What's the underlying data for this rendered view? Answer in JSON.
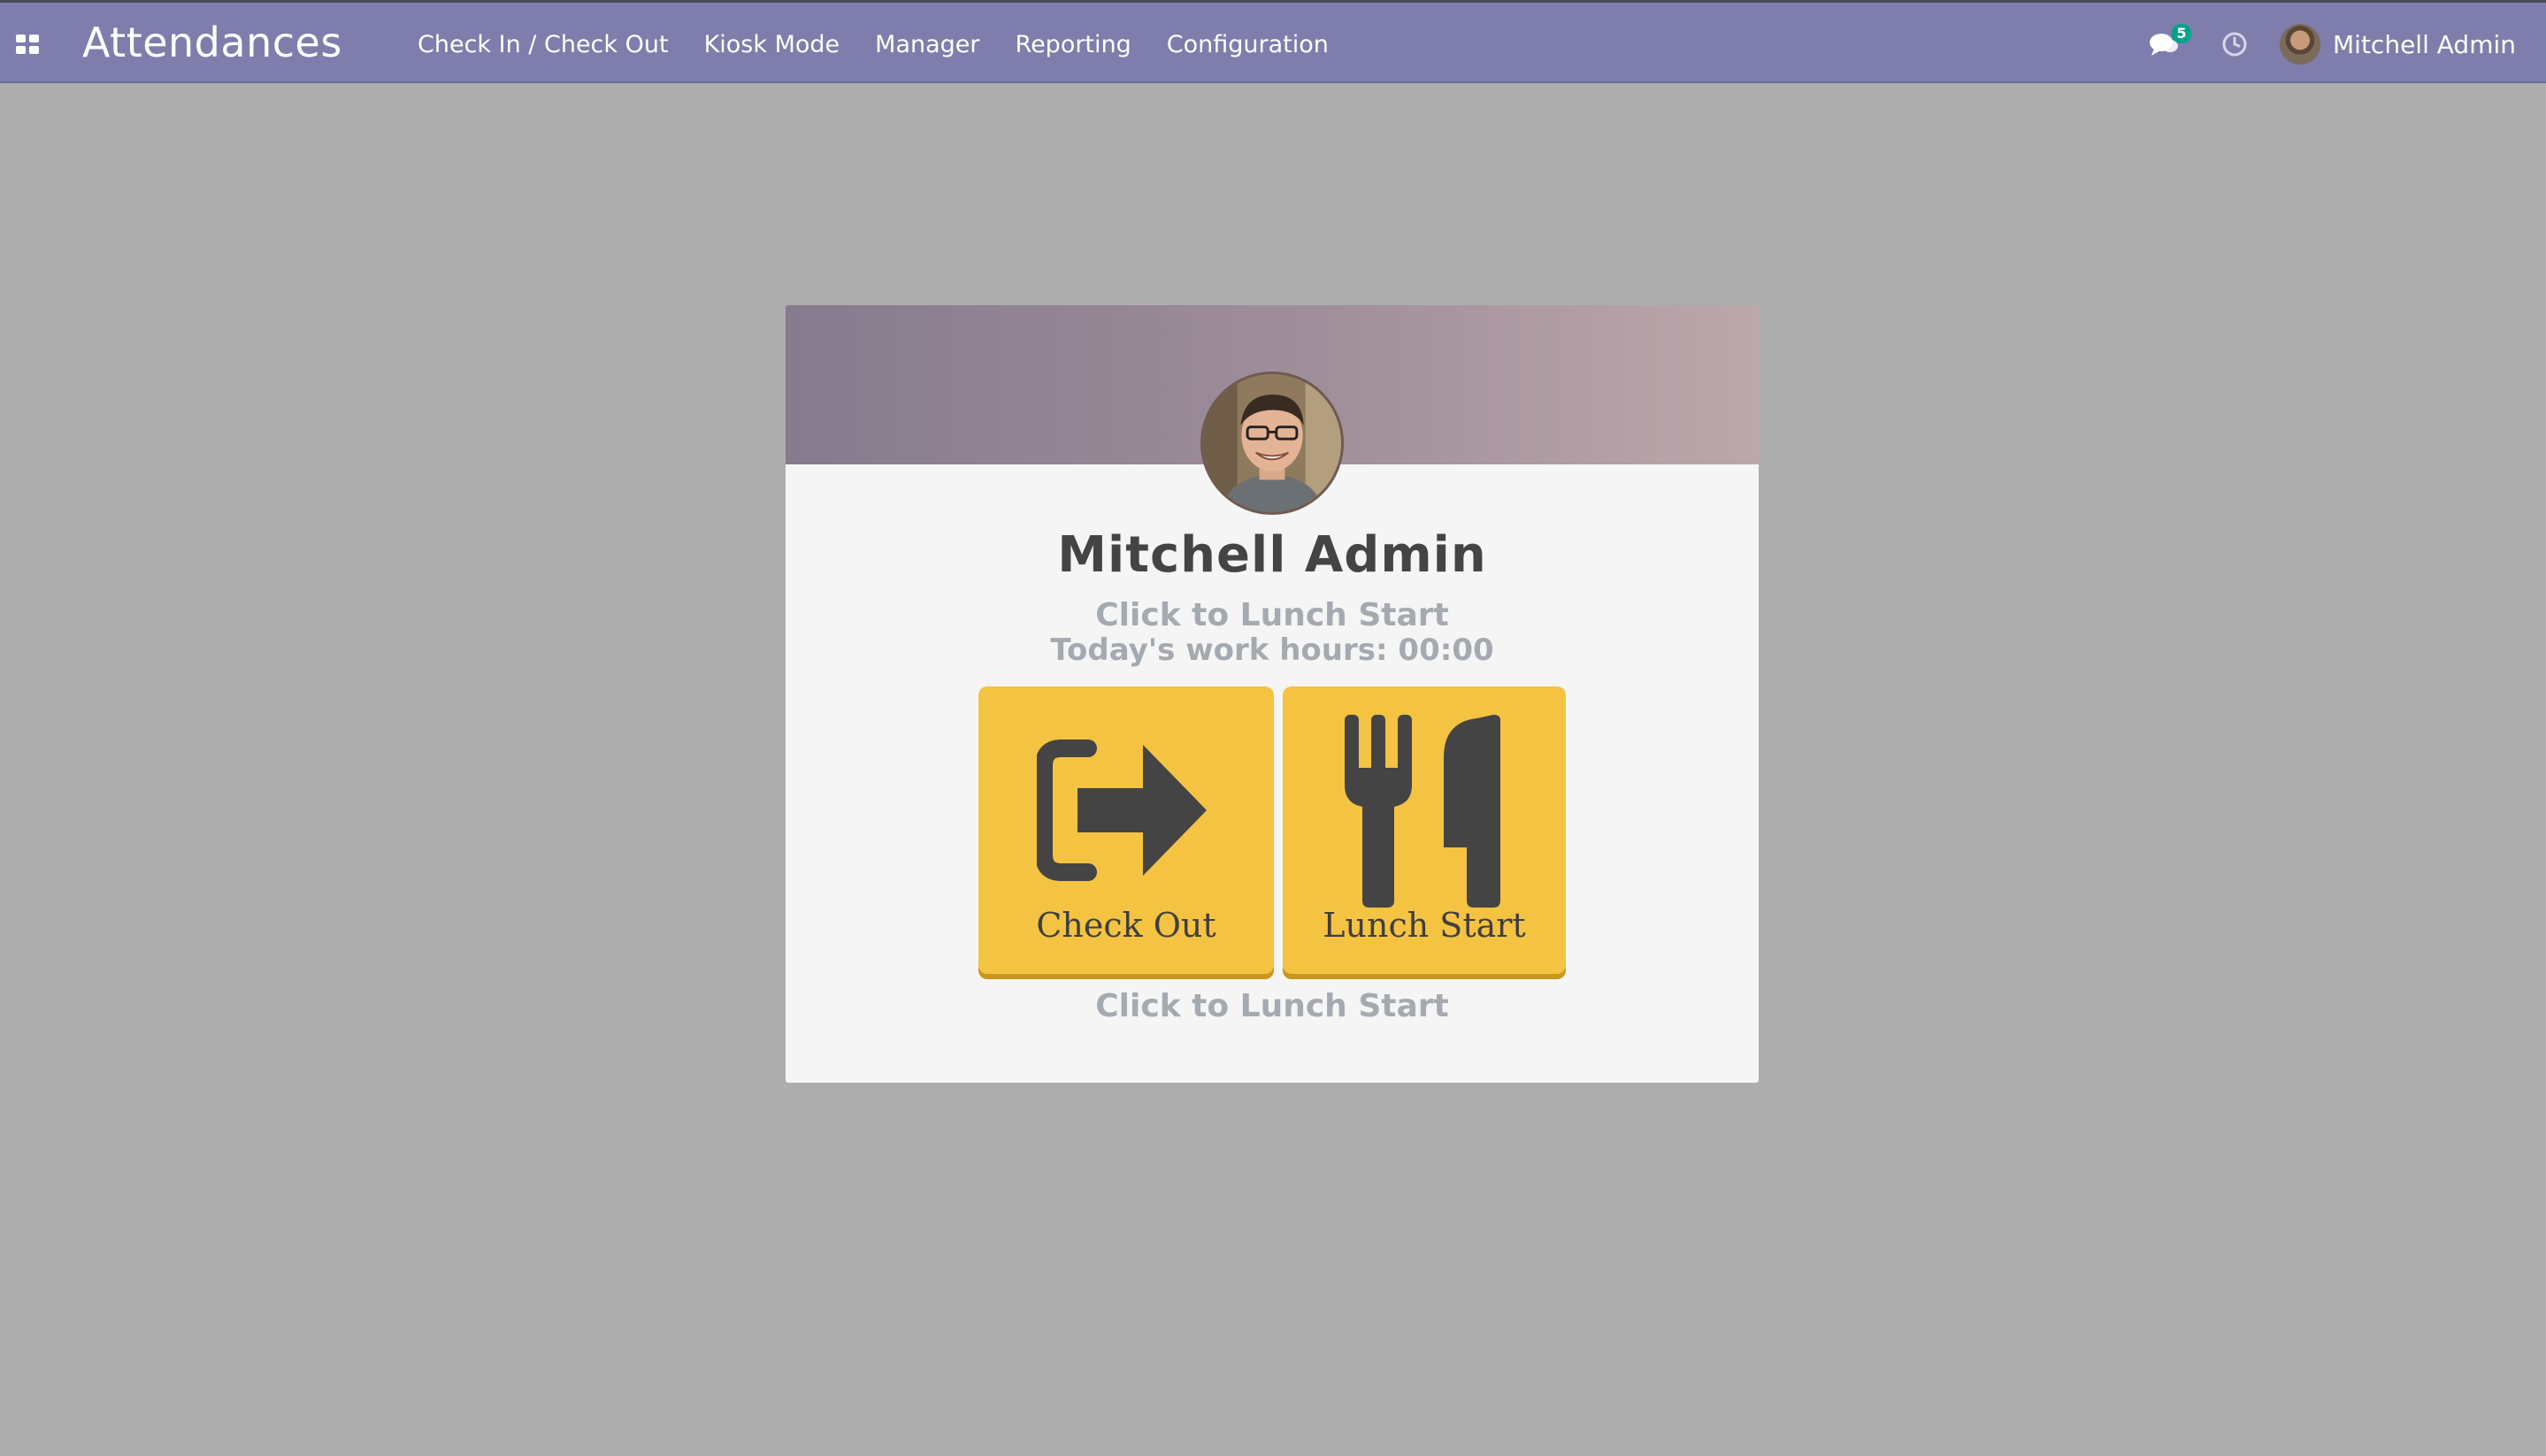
{
  "navbar": {
    "brand": "Attendances",
    "menu": [
      {
        "label": "Check In / Check Out"
      },
      {
        "label": "Kiosk Mode"
      },
      {
        "label": "Manager"
      },
      {
        "label": "Reporting"
      },
      {
        "label": "Configuration"
      }
    ],
    "messages_count": "5",
    "user_name": "Mitchell Admin",
    "icons": {
      "apps": "apps-grid-icon",
      "chat": "chat-icon",
      "activity": "clock-icon"
    },
    "background_color": "#7f7dab"
  },
  "card": {
    "employee_name": "Mitchell Admin",
    "hint_top": "Click to Lunch Start",
    "work_hours": "Today's work hours: 00:00",
    "actions": [
      {
        "label": "Check Out",
        "icon": "sign-out-icon"
      },
      {
        "label": "Lunch Start",
        "icon": "utensils-icon"
      }
    ],
    "hint_bottom": "Click to Lunch Start",
    "button_color": "#f5c342"
  }
}
